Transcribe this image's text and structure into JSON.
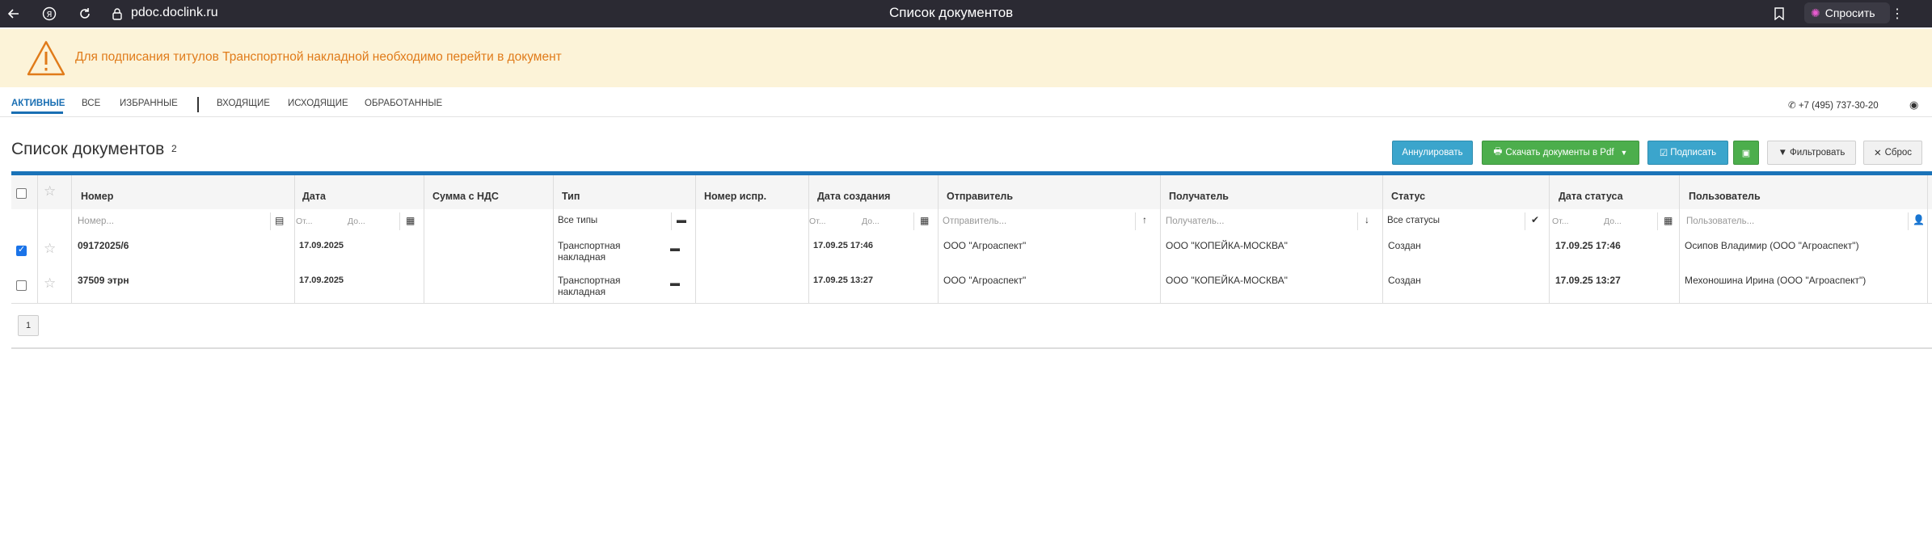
{
  "browser": {
    "url": "pdoc.doclink.ru",
    "title": "Список документов",
    "ask_label": "Спросить"
  },
  "banner": {
    "text": "Для подписания титулов Транспортной накладной необходимо перейти в документ",
    "color": "#e07b1a"
  },
  "tabs": [
    {
      "label": "АКТИВНЫЕ"
    },
    {
      "label": "ВСЕ"
    },
    {
      "label": "ИЗБРАННЫЕ"
    },
    {
      "label": "ВХОДЯЩИЕ"
    },
    {
      "label": "ИСХОДЯЩИЕ"
    },
    {
      "label": "ОБРАБОТАННЫЕ"
    }
  ],
  "phone": "+7 (495) 737-30-20",
  "page": {
    "title": "Список документов",
    "count": "2"
  },
  "toolbar": {
    "annul": "Аннулировать",
    "download_pdf": "Скачать документы в Pdf",
    "sign": "Подписать",
    "filter": "Фильтровать",
    "reset": "Сброс"
  },
  "columns": {
    "number": "Номер",
    "date": "Дата",
    "sum": "Сумма с НДС",
    "type": "Тип",
    "fix_number": "Номер испр.",
    "created": "Дата создания",
    "sender": "Отправитель",
    "receiver": "Получатель",
    "status": "Статус",
    "status_date": "Дата статуса",
    "user": "Пользователь"
  },
  "filters": {
    "number": "Номер...",
    "from": "От...",
    "to": "До...",
    "type": "Все типы",
    "sender": "Отправитель...",
    "receiver": "Получатель...",
    "status": "Все статусы",
    "user": "Пользователь..."
  },
  "rows": [
    {
      "checked": true,
      "number": "09172025/6",
      "date": "17.09.2025",
      "type_line1": "Транспортная",
      "type_line2": "накладная",
      "created": "17.09.25 17:46",
      "sender": "ООО \"Агроаспект\"",
      "receiver": "ООО \"КОПЕЙКА-МОСКВА\"",
      "status": "Создан",
      "status_date": "17.09.25 17:46",
      "user": "Осипов Владимир (ООО \"Агроаспект\")"
    },
    {
      "checked": false,
      "number": "37509 этрн",
      "date": "17.09.2025",
      "type_line1": "Транспортная",
      "type_line2": "накладная",
      "created": "17.09.25 13:27",
      "sender": "ООО \"Агроаспект\"",
      "receiver": "ООО \"КОПЕЙКА-МОСКВА\"",
      "status": "Создан",
      "status_date": "17.09.25 13:27",
      "user": "Мехоношина Ирина (ООО \"Агроаспект\")"
    }
  ],
  "pager": {
    "page": "1"
  }
}
